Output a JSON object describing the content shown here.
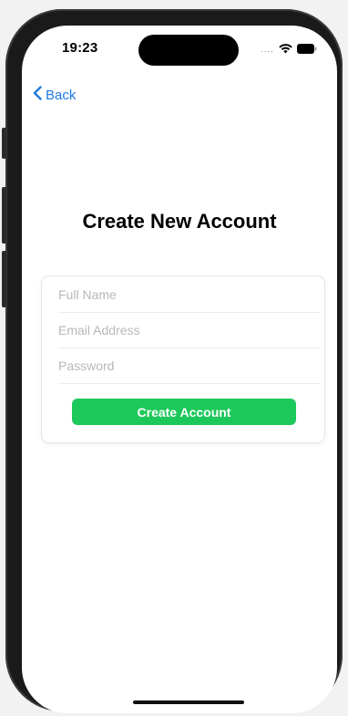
{
  "status_bar": {
    "time": "19:23",
    "signal_dots": "....",
    "icons": [
      "wifi-icon",
      "battery-icon"
    ]
  },
  "nav": {
    "back_label": "Back",
    "back_icon": "chevron-left-icon"
  },
  "page": {
    "title": "Create New Account"
  },
  "form": {
    "full_name": {
      "value": "",
      "placeholder": "Full Name"
    },
    "email": {
      "value": "",
      "placeholder": "Email Address"
    },
    "password": {
      "value": "",
      "placeholder": "Password"
    },
    "submit_label": "Create Account"
  },
  "colors": {
    "accent": "#1f7ae0",
    "primary_button": "#1dc85a"
  }
}
